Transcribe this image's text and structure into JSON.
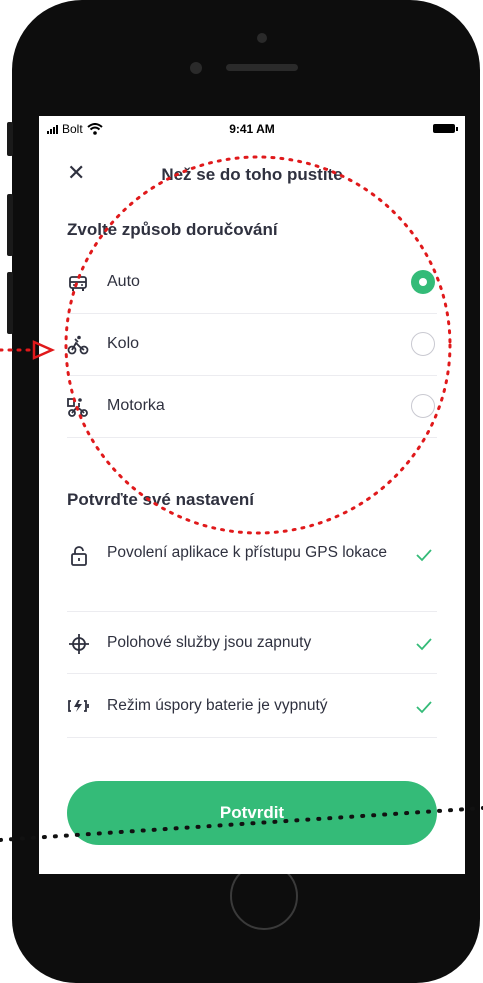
{
  "status_bar": {
    "carrier": "Bolt",
    "time": "9:41 AM"
  },
  "header": {
    "title": "Než se do toho pustíte"
  },
  "delivery": {
    "title": "Zvolte způsob doručování",
    "options": [
      {
        "label": "Auto",
        "icon": "car-icon",
        "selected": true
      },
      {
        "label": "Kolo",
        "icon": "bicycle-icon",
        "selected": false
      },
      {
        "label": "Motorka",
        "icon": "motorbike-icon",
        "selected": false
      }
    ]
  },
  "settings": {
    "title": "Potvrďte své nastavení",
    "items": [
      {
        "label": "Povolení aplikace k přístupu GPS lokace",
        "icon": "lock-icon",
        "confirmed": true
      },
      {
        "label": "Polohové služby jsou zapnuty",
        "icon": "crosshair-icon",
        "confirmed": true
      },
      {
        "label": "Režim úspory baterie je vypnutý",
        "icon": "battery-saver-icon",
        "confirmed": true
      }
    ]
  },
  "actions": {
    "confirm_label": "Potvrdit"
  },
  "colors": {
    "accent": "#34bb78",
    "text": "#2f313f",
    "annotation": "#e0191b"
  }
}
